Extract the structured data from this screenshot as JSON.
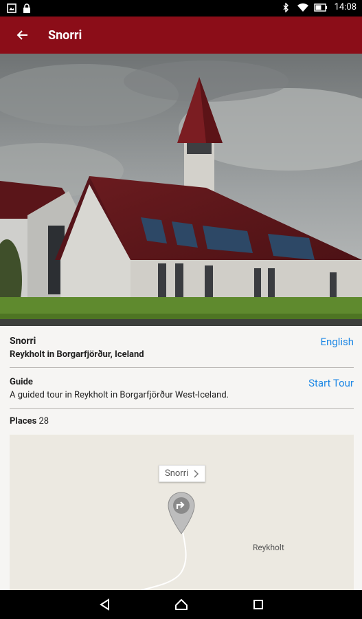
{
  "status_bar": {
    "time": "14:08",
    "left_icons": [
      "image-icon",
      "lock-icon"
    ],
    "right_icons": [
      "bluetooth-icon",
      "wifi-icon",
      "battery-icon"
    ]
  },
  "app_bar": {
    "title": "Snorri",
    "background": "#8b0d18",
    "back_icon": "arrow-back-icon"
  },
  "hero": {
    "image": "church-photo"
  },
  "tour": {
    "title": "Snorri",
    "location": "Reykholt in Borgarfjörður, Iceland",
    "language_label": "English"
  },
  "guide": {
    "heading": "Guide",
    "action_label": "Start Tour",
    "description": "A guided tour in Reykholt in Borgarfjörður West-Iceland."
  },
  "places": {
    "label": "Places",
    "count": "28"
  },
  "map": {
    "callout_label": "Snorri",
    "place_label": "Reykholt"
  },
  "nav_bar": {
    "buttons": [
      "back-triangle-icon",
      "home-icon",
      "recents-icon"
    ]
  },
  "colors": {
    "accent": "#8b0d18",
    "link": "#1e88e5"
  }
}
